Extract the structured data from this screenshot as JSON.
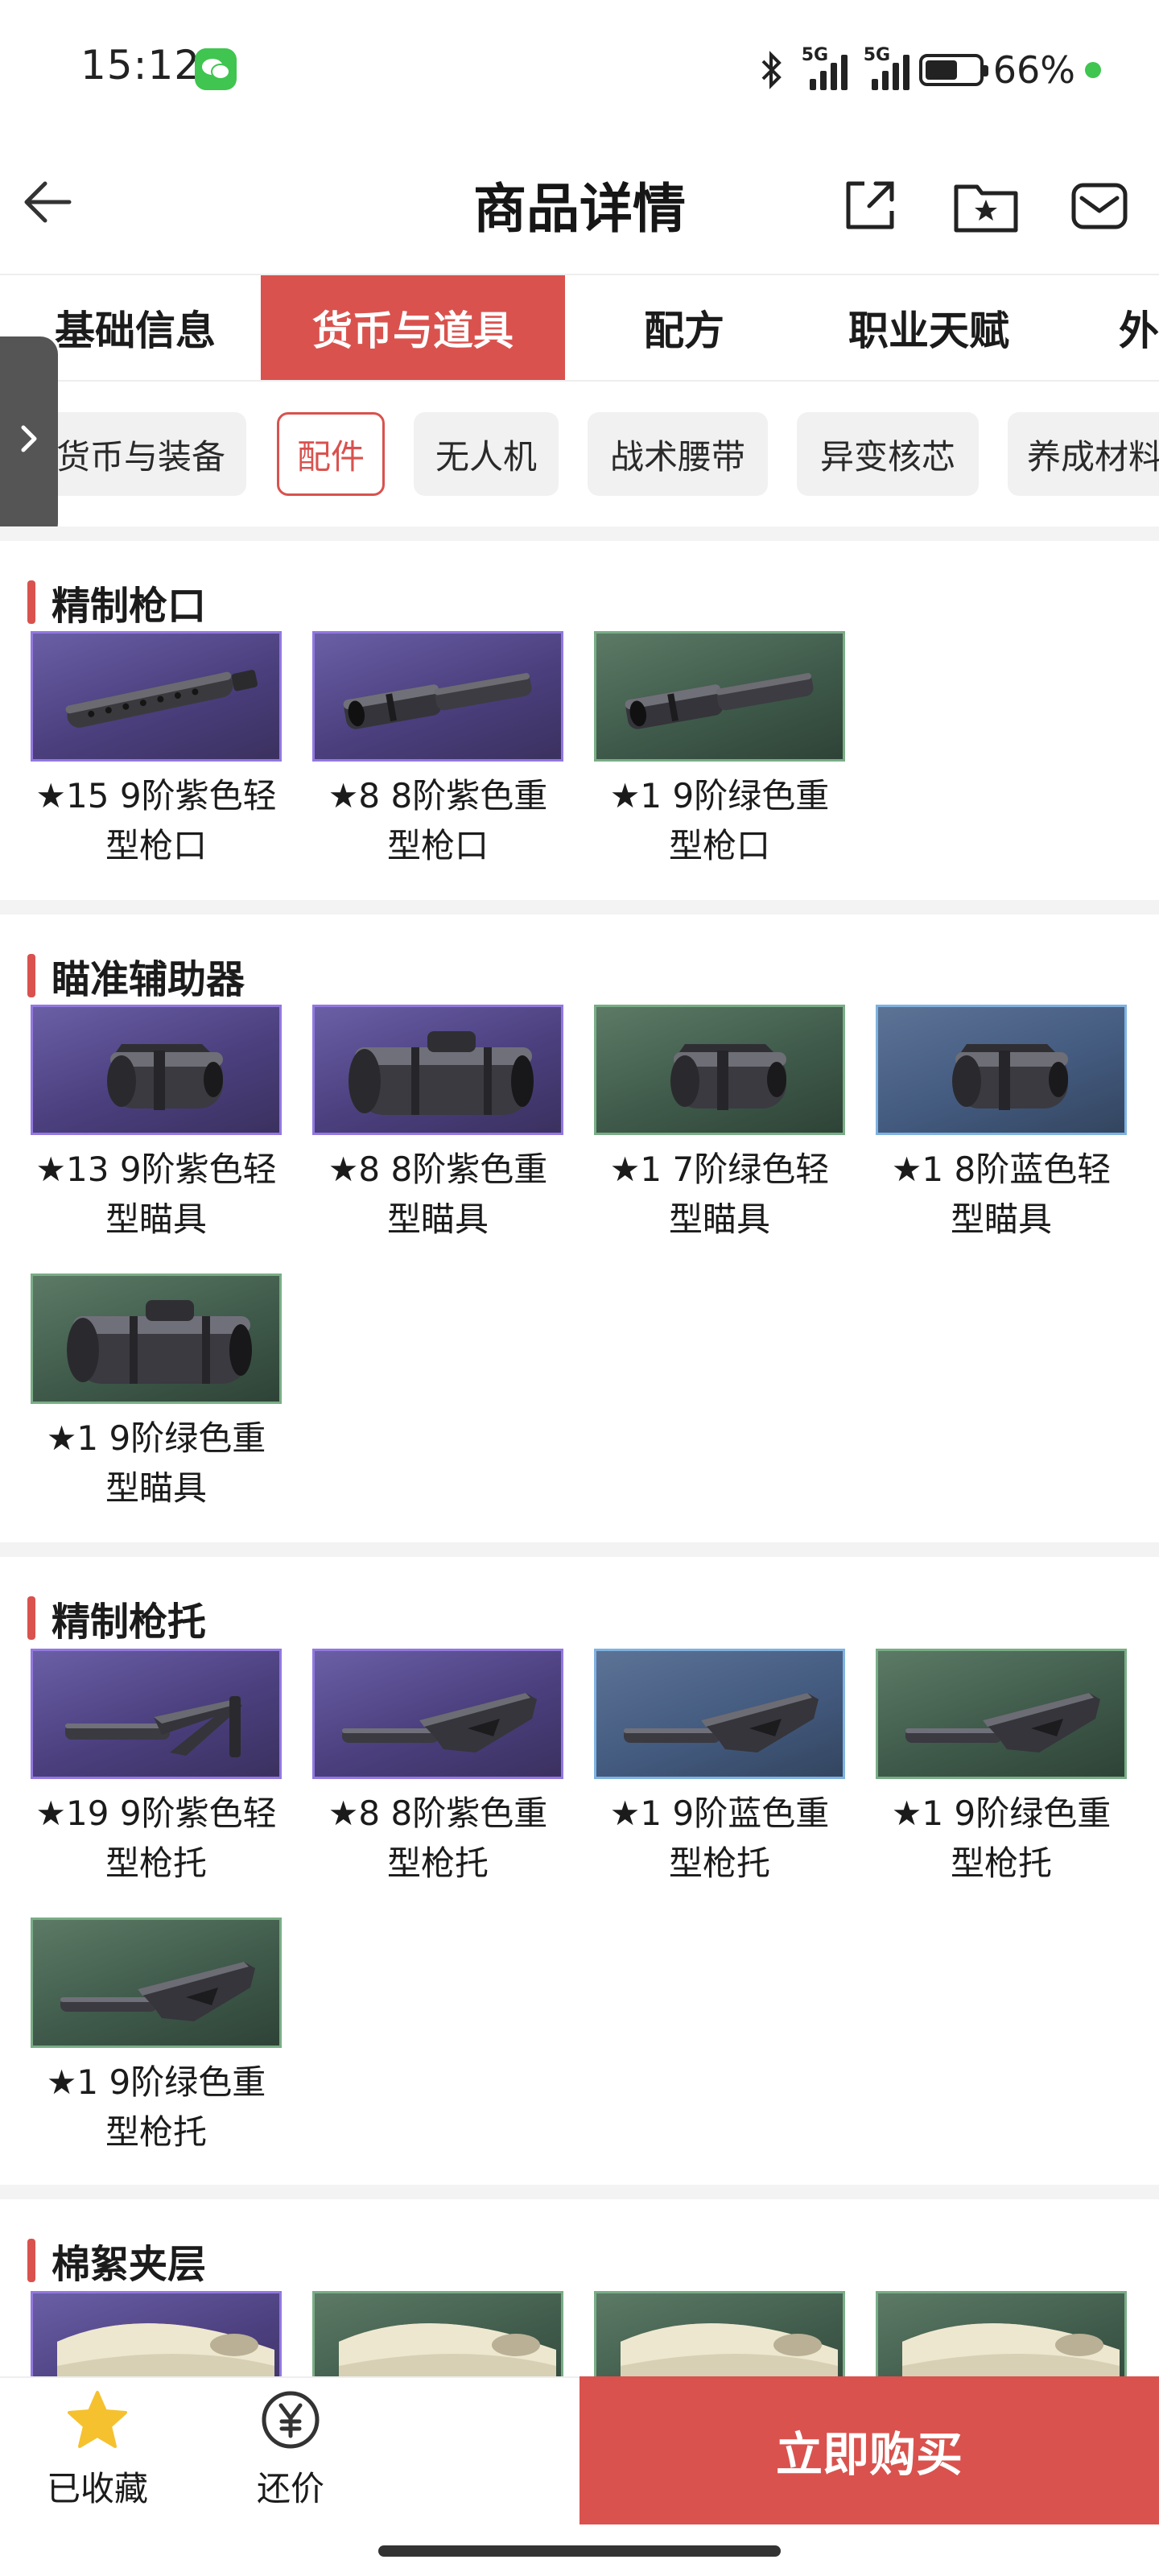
{
  "status_bar": {
    "time": "15:12",
    "net_tag_1": "5G",
    "net_tag_2": "5G",
    "battery": "66%"
  },
  "header": {
    "title": "商品详情"
  },
  "tabs": [
    {
      "label": "基础信息"
    },
    {
      "label": "货币与道具"
    },
    {
      "label": "配方"
    },
    {
      "label": "职业天赋"
    },
    {
      "label": "外"
    }
  ],
  "active_tab": "货币与道具",
  "chips": [
    {
      "label": "货币与装备"
    },
    {
      "label": "配件"
    },
    {
      "label": "无人机"
    },
    {
      "label": "战术腰带"
    },
    {
      "label": "异变核芯"
    },
    {
      "label": "养成材料"
    }
  ],
  "active_chip": "配件",
  "sections": [
    {
      "title": "精制枪口",
      "items": [
        {
          "l1": "★15 9阶紫色轻",
          "l2": "型枪口",
          "color": "purple",
          "icon": "muzzle-brake-light"
        },
        {
          "l1": "★8 8阶紫色重",
          "l2": "型枪口",
          "color": "purple",
          "icon": "muzzle-brake-heavy"
        },
        {
          "l1": "★1 9阶绿色重",
          "l2": "型枪口",
          "color": "green",
          "icon": "muzzle-brake-heavy"
        }
      ]
    },
    {
      "title": "瞄准辅助器",
      "items": [
        {
          "l1": "★13 9阶紫色轻",
          "l2": "型瞄具",
          "color": "purple",
          "icon": "scope-light"
        },
        {
          "l1": "★8 8阶紫色重",
          "l2": "型瞄具",
          "color": "purple",
          "icon": "scope-heavy"
        },
        {
          "l1": "★1 7阶绿色轻",
          "l2": "型瞄具",
          "color": "green",
          "icon": "scope-light"
        },
        {
          "l1": "★1 8阶蓝色轻",
          "l2": "型瞄具",
          "color": "blue",
          "icon": "scope-light"
        },
        {
          "l1": "★1 9阶绿色重",
          "l2": "型瞄具",
          "color": "green",
          "icon": "scope-heavy"
        }
      ]
    },
    {
      "title": "精制枪托",
      "items": [
        {
          "l1": "★19 9阶紫色轻",
          "l2": "型枪托",
          "color": "purple",
          "icon": "stock-light"
        },
        {
          "l1": "★8 8阶紫色重",
          "l2": "型枪托",
          "color": "purple",
          "icon": "stock-heavy"
        },
        {
          "l1": "★1 9阶蓝色重",
          "l2": "型枪托",
          "color": "blue",
          "icon": "stock-heavy"
        },
        {
          "l1": "★1 9阶绿色重",
          "l2": "型枪托",
          "color": "green",
          "icon": "stock-heavy"
        },
        {
          "l1": "★1 9阶绿色重",
          "l2": "型枪托",
          "color": "green",
          "icon": "stock-heavy"
        }
      ]
    },
    {
      "title": "棉絮夹层",
      "items": [
        {
          "color": "purple",
          "icon": "cotton-liner-roll"
        },
        {
          "color": "green",
          "icon": "cotton-liner-roll"
        },
        {
          "color": "green",
          "icon": "cotton-liner-roll"
        },
        {
          "color": "green",
          "icon": "cotton-liner-roll"
        }
      ]
    }
  ],
  "bottom_bar": {
    "favorite_label": "已收藏",
    "bargain_label": "还价",
    "buy_label": "立即购买"
  },
  "colors": {
    "accent": "#d9524e",
    "purple_tier": "#9278e0",
    "green_tier": "#79ad86",
    "blue_tier": "#7fb2e0"
  }
}
